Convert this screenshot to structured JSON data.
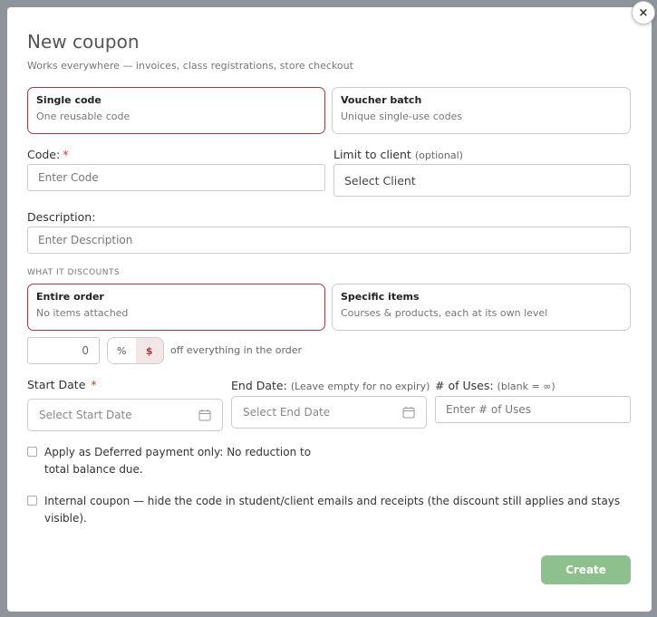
{
  "modal": {
    "close_label": "×",
    "title": "New coupon",
    "subtitle": "Works everywhere — invoices, class registrations, store checkout"
  },
  "code_type": {
    "single": {
      "title": "Single code",
      "subtitle": "One reusable code",
      "selected": true
    },
    "batch": {
      "title": "Voucher batch",
      "subtitle": "Unique single-use codes",
      "selected": false
    }
  },
  "code": {
    "label": "Code:",
    "required_mark": "*",
    "placeholder": "Enter Code"
  },
  "client": {
    "label": "Limit to client",
    "hint": "(optional)",
    "value": "Select Client"
  },
  "description": {
    "label": "Description:",
    "placeholder": "Enter Description"
  },
  "discounts": {
    "section_label": "WHAT IT DISCOUNTS",
    "entire": {
      "title": "Entire order",
      "subtitle": "No items attached",
      "selected": true
    },
    "specific": {
      "title": "Specific items",
      "subtitle": "Courses & products, each at its own level",
      "selected": false
    }
  },
  "amount": {
    "value": "0",
    "percent_label": "%",
    "dollar_label": "$",
    "selected_unit": "$",
    "suffix": "off everything in the order"
  },
  "start_date": {
    "label": "Start Date",
    "required_mark": "*",
    "placeholder": "Select Start Date"
  },
  "end_date": {
    "label": "End Date:",
    "hint": "(Leave empty for no expiry)",
    "placeholder": "Select End Date"
  },
  "uses": {
    "label": "# of Uses:",
    "hint": "(blank = ∞)",
    "placeholder": "Enter # of Uses"
  },
  "options": {
    "deferred": {
      "label": "Apply as Deferred payment only: No reduction to total balance due.",
      "checked": false
    },
    "internal": {
      "label": "Internal coupon — hide the code in student/client emails and receipts (the discount still applies and stays visible).",
      "checked": false
    }
  },
  "actions": {
    "create_label": "Create",
    "create_color": "#8dc08d"
  },
  "colors": {
    "accent": "#a63a48",
    "required": "#dd3333"
  },
  "icons": {
    "close": "close-icon",
    "calendar": "calendar-icon"
  }
}
